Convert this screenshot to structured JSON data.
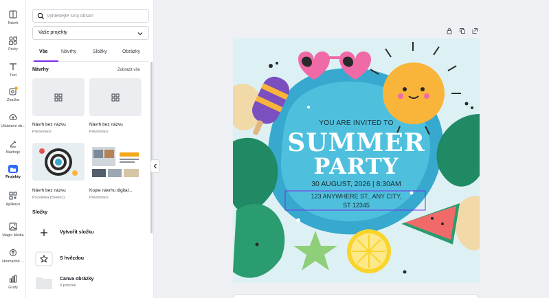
{
  "rail": [
    {
      "label": "Návrh",
      "icon": "layout-icon"
    },
    {
      "label": "Prvky",
      "icon": "elements-icon"
    },
    {
      "label": "Text",
      "icon": "text-icon"
    },
    {
      "label": "Značka",
      "icon": "brand-icon"
    },
    {
      "label": "Ukládané ob...",
      "icon": "uploads-icon"
    },
    {
      "label": "Nástroje",
      "icon": "tools-icon"
    },
    {
      "label": "Projekty",
      "icon": "folder-icon"
    },
    {
      "label": "Aplikace",
      "icon": "apps-icon"
    },
    {
      "label": "Magic Media",
      "icon": "magic-media-icon"
    },
    {
      "label": "Hromadné ...",
      "icon": "bulk-create-icon"
    },
    {
      "label": "Grafy",
      "icon": "chart-icon"
    }
  ],
  "panel": {
    "search_placeholder": "Vyhledejte svůj obsah",
    "dropdown_value": "Vaše projekty",
    "tabs": [
      "Vše",
      "Návrhy",
      "Složky",
      "Obrázky"
    ],
    "designs_title": "Návrhy",
    "see_all": "Zobrazit vše",
    "designs": [
      {
        "title": "Návrh bez názvu",
        "subtitle": "Prezentace"
      },
      {
        "title": "Návrh bez názvu",
        "subtitle": "Prezentace"
      },
      {
        "title": "Návrh bez názvu",
        "subtitle": "Pozvánka (čtverec)"
      },
      {
        "title": "Kopie návrhu digital...",
        "subtitle": "Prezentace"
      }
    ],
    "folders_title": "Složky",
    "folders": [
      {
        "label": "Vytvořit složku",
        "sub": ""
      },
      {
        "label": "S hvězdou",
        "sub": ""
      },
      {
        "label": "Canva obrázky",
        "sub": "0 položek"
      }
    ]
  },
  "design": {
    "invited": "YOU ARE INVITED TO",
    "line1": "SUMMER",
    "line2": "PARTY",
    "date": "30 AUGUST, 2026 | 8:30AM",
    "addr1": "123 ANYWHERE ST., ANY CITY,",
    "addr2": "ST 12345"
  },
  "colors": {
    "accent": "#7d2ae8",
    "active_blue": "#2f6df6",
    "pool": "#37a9cf",
    "sun": "#f9b43a",
    "pink": "#f06aa8"
  }
}
